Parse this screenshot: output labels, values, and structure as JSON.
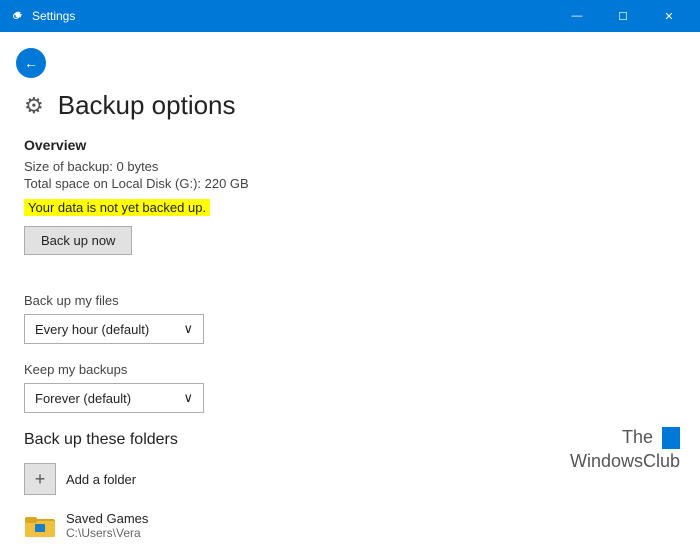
{
  "titlebar": {
    "title": "Settings",
    "minimize_label": "—",
    "maximize_label": "☐",
    "close_label": "✕"
  },
  "back_button_label": "←",
  "page_header": {
    "icon": "⚙",
    "title": "Backup options"
  },
  "overview": {
    "section_title": "Overview",
    "size_line": "Size of backup: 0 bytes",
    "space_line": "Total space on Local Disk (G:): 220 GB",
    "warning_text": "Your data is not yet backed up.",
    "backup_now_label": "Back up now"
  },
  "backup_frequency": {
    "label": "Back up my files",
    "value": "Every hour (default)",
    "chevron": "∨"
  },
  "keep_backups": {
    "label": "Keep my backups",
    "value": "Forever (default)",
    "chevron": "∨"
  },
  "folders_section": {
    "title": "Back up these folders",
    "add_folder_label": "Add a folder",
    "add_icon": "+",
    "folders": [
      {
        "name": "Saved Games",
        "path": "C:\\Users\\Vera"
      }
    ]
  },
  "watermark": {
    "line1": "The",
    "line2": "WindowsClub"
  }
}
